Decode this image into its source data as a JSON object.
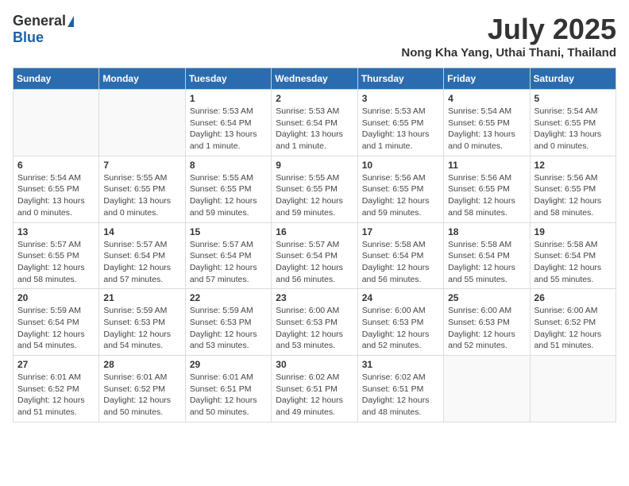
{
  "header": {
    "logo_general": "General",
    "logo_blue": "Blue",
    "month_title": "July 2025",
    "location": "Nong Kha Yang, Uthai Thani, Thailand"
  },
  "days_of_week": [
    "Sunday",
    "Monday",
    "Tuesday",
    "Wednesday",
    "Thursday",
    "Friday",
    "Saturday"
  ],
  "weeks": [
    [
      {
        "day": "",
        "info": ""
      },
      {
        "day": "",
        "info": ""
      },
      {
        "day": "1",
        "info": "Sunrise: 5:53 AM\nSunset: 6:54 PM\nDaylight: 13 hours and 1 minute."
      },
      {
        "day": "2",
        "info": "Sunrise: 5:53 AM\nSunset: 6:54 PM\nDaylight: 13 hours and 1 minute."
      },
      {
        "day": "3",
        "info": "Sunrise: 5:53 AM\nSunset: 6:55 PM\nDaylight: 13 hours and 1 minute."
      },
      {
        "day": "4",
        "info": "Sunrise: 5:54 AM\nSunset: 6:55 PM\nDaylight: 13 hours and 0 minutes."
      },
      {
        "day": "5",
        "info": "Sunrise: 5:54 AM\nSunset: 6:55 PM\nDaylight: 13 hours and 0 minutes."
      }
    ],
    [
      {
        "day": "6",
        "info": "Sunrise: 5:54 AM\nSunset: 6:55 PM\nDaylight: 13 hours and 0 minutes."
      },
      {
        "day": "7",
        "info": "Sunrise: 5:55 AM\nSunset: 6:55 PM\nDaylight: 13 hours and 0 minutes."
      },
      {
        "day": "8",
        "info": "Sunrise: 5:55 AM\nSunset: 6:55 PM\nDaylight: 12 hours and 59 minutes."
      },
      {
        "day": "9",
        "info": "Sunrise: 5:55 AM\nSunset: 6:55 PM\nDaylight: 12 hours and 59 minutes."
      },
      {
        "day": "10",
        "info": "Sunrise: 5:56 AM\nSunset: 6:55 PM\nDaylight: 12 hours and 59 minutes."
      },
      {
        "day": "11",
        "info": "Sunrise: 5:56 AM\nSunset: 6:55 PM\nDaylight: 12 hours and 58 minutes."
      },
      {
        "day": "12",
        "info": "Sunrise: 5:56 AM\nSunset: 6:55 PM\nDaylight: 12 hours and 58 minutes."
      }
    ],
    [
      {
        "day": "13",
        "info": "Sunrise: 5:57 AM\nSunset: 6:55 PM\nDaylight: 12 hours and 58 minutes."
      },
      {
        "day": "14",
        "info": "Sunrise: 5:57 AM\nSunset: 6:54 PM\nDaylight: 12 hours and 57 minutes."
      },
      {
        "day": "15",
        "info": "Sunrise: 5:57 AM\nSunset: 6:54 PM\nDaylight: 12 hours and 57 minutes."
      },
      {
        "day": "16",
        "info": "Sunrise: 5:57 AM\nSunset: 6:54 PM\nDaylight: 12 hours and 56 minutes."
      },
      {
        "day": "17",
        "info": "Sunrise: 5:58 AM\nSunset: 6:54 PM\nDaylight: 12 hours and 56 minutes."
      },
      {
        "day": "18",
        "info": "Sunrise: 5:58 AM\nSunset: 6:54 PM\nDaylight: 12 hours and 55 minutes."
      },
      {
        "day": "19",
        "info": "Sunrise: 5:58 AM\nSunset: 6:54 PM\nDaylight: 12 hours and 55 minutes."
      }
    ],
    [
      {
        "day": "20",
        "info": "Sunrise: 5:59 AM\nSunset: 6:54 PM\nDaylight: 12 hours and 54 minutes."
      },
      {
        "day": "21",
        "info": "Sunrise: 5:59 AM\nSunset: 6:53 PM\nDaylight: 12 hours and 54 minutes."
      },
      {
        "day": "22",
        "info": "Sunrise: 5:59 AM\nSunset: 6:53 PM\nDaylight: 12 hours and 53 minutes."
      },
      {
        "day": "23",
        "info": "Sunrise: 6:00 AM\nSunset: 6:53 PM\nDaylight: 12 hours and 53 minutes."
      },
      {
        "day": "24",
        "info": "Sunrise: 6:00 AM\nSunset: 6:53 PM\nDaylight: 12 hours and 52 minutes."
      },
      {
        "day": "25",
        "info": "Sunrise: 6:00 AM\nSunset: 6:53 PM\nDaylight: 12 hours and 52 minutes."
      },
      {
        "day": "26",
        "info": "Sunrise: 6:00 AM\nSunset: 6:52 PM\nDaylight: 12 hours and 51 minutes."
      }
    ],
    [
      {
        "day": "27",
        "info": "Sunrise: 6:01 AM\nSunset: 6:52 PM\nDaylight: 12 hours and 51 minutes."
      },
      {
        "day": "28",
        "info": "Sunrise: 6:01 AM\nSunset: 6:52 PM\nDaylight: 12 hours and 50 minutes."
      },
      {
        "day": "29",
        "info": "Sunrise: 6:01 AM\nSunset: 6:51 PM\nDaylight: 12 hours and 50 minutes."
      },
      {
        "day": "30",
        "info": "Sunrise: 6:02 AM\nSunset: 6:51 PM\nDaylight: 12 hours and 49 minutes."
      },
      {
        "day": "31",
        "info": "Sunrise: 6:02 AM\nSunset: 6:51 PM\nDaylight: 12 hours and 48 minutes."
      },
      {
        "day": "",
        "info": ""
      },
      {
        "day": "",
        "info": ""
      }
    ]
  ]
}
